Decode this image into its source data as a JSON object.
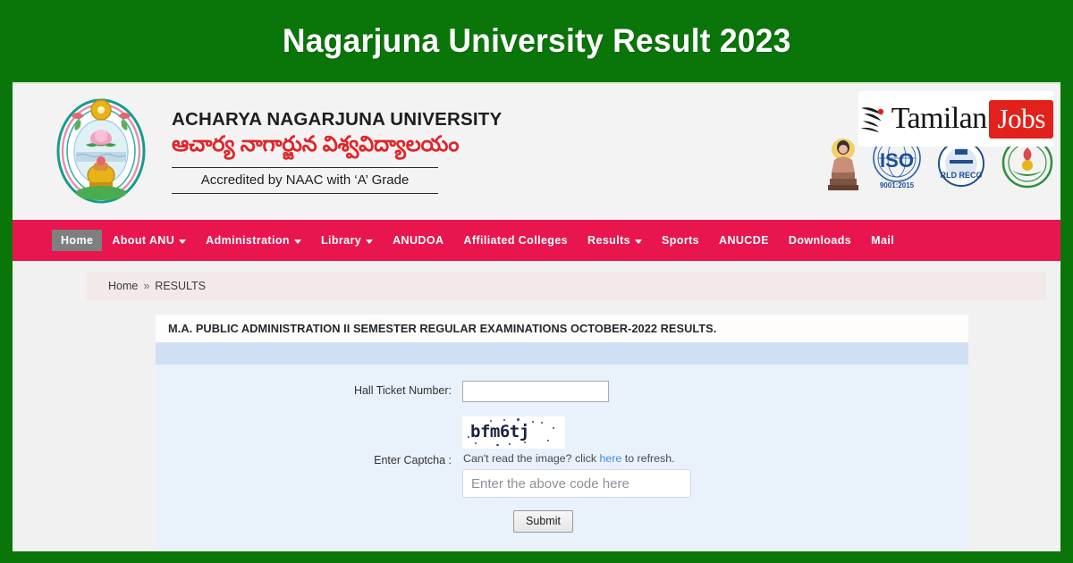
{
  "banner": {
    "title": "Nagarjuna University Result 2023",
    "background_color": "#0a7508",
    "text_color": "#ffffff"
  },
  "site_header": {
    "emblem_icon": "university-seal-icon",
    "university_name_en": "ACHARYA NAGARJUNA UNIVERSITY",
    "university_name_te": "ఆచార్య నాగార్జున విశ్వవిద్యాలయం",
    "accreditation": "Accredited by NAAC with  ‘A’  Grade",
    "badges": [
      {
        "name": "buddha-statue-icon",
        "label": ""
      },
      {
        "name": "iso-certification-icon",
        "label": "ISO",
        "sub": "9001:2015"
      },
      {
        "name": "world-record-icon",
        "label": "RLD RECO"
      },
      {
        "name": "emblem-badge-icon",
        "label": ""
      }
    ],
    "watermark": {
      "swoosh_icon": "tamilan-swoosh-icon",
      "word_one": "Tamilan",
      "word_two": "Jobs",
      "accent_color": "#e2211c"
    }
  },
  "navbar": {
    "background_color": "#e8154e",
    "active_background_color": "#7f7f7f",
    "items": [
      {
        "label": "Home",
        "active": true,
        "caret": false
      },
      {
        "label": "About ANU",
        "active": false,
        "caret": true
      },
      {
        "label": "Administration",
        "active": false,
        "caret": true
      },
      {
        "label": "Library",
        "active": false,
        "caret": true
      },
      {
        "label": "ANUDOA",
        "active": false,
        "caret": false
      },
      {
        "label": "Affiliated Colleges",
        "active": false,
        "caret": false
      },
      {
        "label": "Results",
        "active": false,
        "caret": true
      },
      {
        "label": "Sports",
        "active": false,
        "caret": false
      },
      {
        "label": "ANUCDE",
        "active": false,
        "caret": false
      },
      {
        "label": "Downloads",
        "active": false,
        "caret": false
      },
      {
        "label": "Mail",
        "active": false,
        "caret": false
      }
    ]
  },
  "breadcrumb": {
    "home": "Home",
    "separator": "»",
    "current": "RESULTS"
  },
  "panel": {
    "title": "M.A. PUBLIC ADMINISTRATION II SEMESTER REGULAR EXAMINATIONS OCTOBER-2022 RESULTS.",
    "hall_ticket": {
      "label": "Hall Ticket Number:",
      "value": "",
      "placeholder": ""
    },
    "captcha": {
      "label": "Enter Captcha :",
      "image_text": "bfm6tj",
      "refresh_prefix": "Can't read the image? click ",
      "refresh_link": "here",
      "refresh_suffix": " to refresh.",
      "link_color": "#3b8fe0",
      "input_value": "",
      "input_placeholder": "Enter the above code here"
    },
    "submit_label": "Submit"
  }
}
